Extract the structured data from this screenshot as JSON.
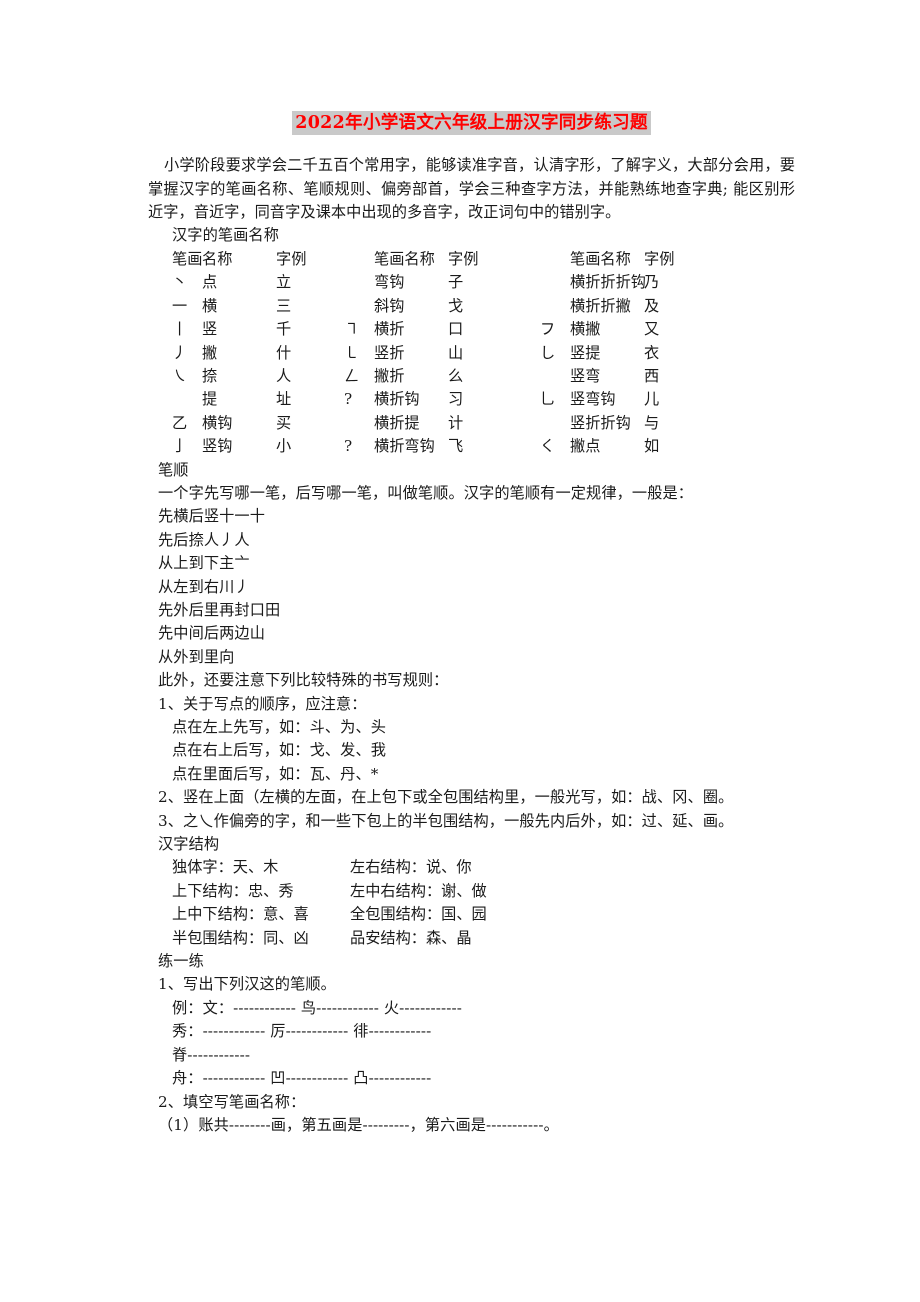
{
  "document": {
    "title": "2022年小学语文六年级上册汉字同步练习题",
    "title_color": "#ff0000",
    "title_highlight": "#c9c9c9",
    "intro": "小学阶段要求学会二千五百个常用字，能够读准字音，认清字形，了解字义，大部分会用，要掌握汉字的笔画名称、笔顺规则、偏旁部首，学会三种查字方法，并能熟练地查字典; 能区别形近字，音近字，同音字及课本中出现的多音字，改正词句中的错别字。",
    "section_strokes_heading": "汉字的笔画名称",
    "stroke_table": {
      "headers": {
        "col1": [
          "笔画",
          "名称",
          "字例"
        ],
        "col2": [
          "笔画名称",
          "字例"
        ],
        "col3": [
          "笔画名称",
          "字例"
        ]
      },
      "header_line": {
        "c1_mark": "笔画",
        "c1_name": "名称",
        "c1_ex": "字例",
        "c2_mark": "",
        "c2_name": "笔画名称",
        "c2_ex": "字例",
        "c3_mark": "",
        "c3_name": "笔画名称",
        "c3_ex": "字例"
      },
      "rows": [
        {
          "c1_mark": "丶",
          "c1_name": "点",
          "c1_ex": "立",
          "c2_mark": "",
          "c2_name": "弯钩",
          "c2_ex": "子",
          "c3_mark": "",
          "c3_name": "横折折折钩",
          "c3_ex": "乃"
        },
        {
          "c1_mark": "一",
          "c1_name": "横",
          "c1_ex": "三",
          "c2_mark": "",
          "c2_name": "斜钩",
          "c2_ex": "戈",
          "c3_mark": "",
          "c3_name": "横折折撇",
          "c3_ex": "及"
        },
        {
          "c1_mark": "丨",
          "c1_name": "竖",
          "c1_ex": "千",
          "c2_mark": "㇕",
          "c2_name": "横折",
          "c2_ex": "口",
          "c3_mark": "フ",
          "c3_name": "横撇",
          "c3_ex": "又"
        },
        {
          "c1_mark": "丿",
          "c1_name": "撇",
          "c1_ex": "什",
          "c2_mark": "㇄",
          "c2_name": "竖折",
          "c2_ex": "山",
          "c3_mark": "し",
          "c3_name": "竖提",
          "c3_ex": "衣"
        },
        {
          "c1_mark": "㇏",
          "c1_name": "捺",
          "c1_ex": "人",
          "c2_mark": "ㄥ",
          "c2_name": "撇折",
          "c2_ex": "么",
          "c3_mark": "",
          "c3_name": "竖弯",
          "c3_ex": "西"
        },
        {
          "c1_mark": "",
          "c1_name": "提",
          "c1_ex": "址",
          "c2_mark": "?",
          "c2_name": "横折钩",
          "c2_ex": "习",
          "c3_mark": "乚",
          "c3_name": "竖弯钩",
          "c3_ex": "儿"
        },
        {
          "c1_mark": "⼄",
          "c1_name": "横钩",
          "c1_ex": "买",
          "c2_mark": "",
          "c2_name": "横折提",
          "c2_ex": "计",
          "c3_mark": "",
          "c3_name": "竖折折钩",
          "c3_ex": "与"
        },
        {
          "c1_mark": "亅",
          "c1_name": "竖钩",
          "c1_ex": "小",
          "c2_mark": "?",
          "c2_name": "横折弯钩",
          "c2_ex": "飞",
          "c3_mark": "く",
          "c3_name": "撇点",
          "c3_ex": "如"
        }
      ]
    },
    "section_order_heading": "笔顺",
    "order_intro": "一个字先写哪一笔，后写哪一笔，叫做笔顺。汉字的笔顺有一定规律，一般是：",
    "order_rules": [
      "先横后竖十一十",
      "先后捺人丿人",
      "从上到下主亠",
      "从左到右川丿",
      "先外后里再封口田",
      "先中间后两边山",
      "从外到里向"
    ],
    "special_intro": "此外，还要注意下列比较特殊的书写规则：",
    "special_rules": [
      "1、关于写点的顺序，应注意：",
      "点在左上先写，如：斗、为、头",
      "点在右上后写，如：戈、发、我",
      "点在里面后写，如：瓦、丹、*",
      "2、竖在上面（左横的左面，在上包下或全包围结构里，一般光写，如：战、冈、圈。",
      "3、之乀作偏旁的字，和一些下包上的半包围结构，一般先内后外，如：过、延、画。"
    ],
    "section_structure_heading": "汉字结构",
    "structure_rows": [
      {
        "left": "独体字：天、木",
        "right": "左右结构：说、你"
      },
      {
        "left": "上下结构：忠、秀",
        "right": "左中右结构：谢、做"
      },
      {
        "left": "上中下结构：意、喜",
        "right": "全包围结构：国、园"
      },
      {
        "left": "半包围结构：同、凶",
        "right": "品安结构：森、晶"
      }
    ],
    "section_practice_heading": "练一练",
    "practice": [
      "1、写出下列汉这的笔顺。",
      "例：文：------------ 鸟------------ 火------------",
      "秀：------------ 厉------------ 徘------------",
      "脊------------",
      "舟：------------ 凹------------ 凸------------",
      "2、填空写笔画名称：",
      "（1）账共--------画，第五画是---------，第六画是-----------。"
    ]
  }
}
